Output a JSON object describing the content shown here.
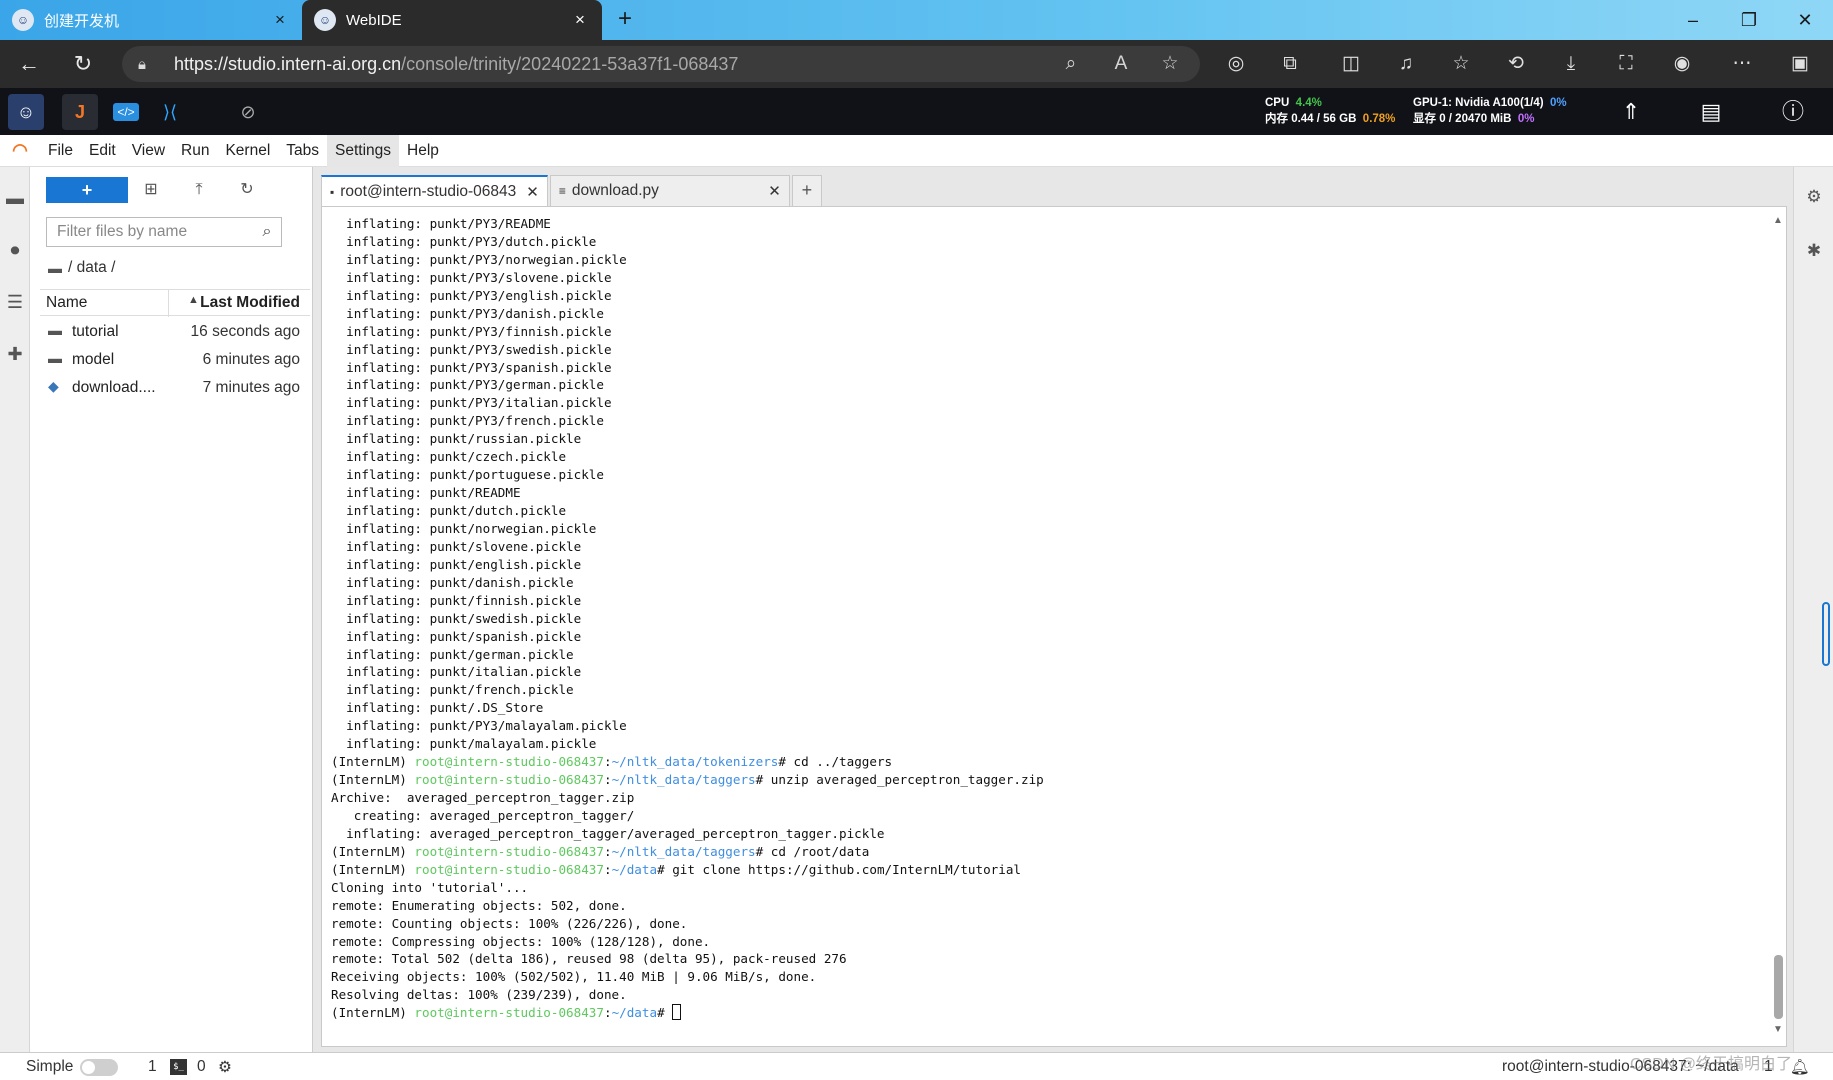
{
  "browser": {
    "tabs": [
      {
        "title": "创建开发机",
        "close": "×"
      },
      {
        "title": "WebIDE",
        "close": "×"
      }
    ],
    "new_tab": "+",
    "window_controls": {
      "minimize": "–",
      "maximize": "❐",
      "close": "✕"
    },
    "url_host": "https://studio.intern-ai.org.cn",
    "url_path": "/console/trinity/20240221-53a37f1-068437"
  },
  "ide_bar": {
    "cpu_label": "CPU",
    "cpu_value": "4.4%",
    "mem_label": "内存 0.44 / 56 GB",
    "mem_value": "0.78%",
    "gpu_label": "GPU-1: Nvidia A100(1/4)",
    "gpu_value": "0%",
    "vram_label": "显存 0 / 20470 MiB",
    "vram_value": "0%"
  },
  "menu": [
    "File",
    "Edit",
    "View",
    "Run",
    "Kernel",
    "Tabs",
    "Settings",
    "Help"
  ],
  "menu_selected": "Settings",
  "file_browser": {
    "new_label": "+",
    "filter_placeholder": "Filter files by name",
    "breadcrumb": "/ data /",
    "col_name": "Name",
    "col_modified": "Last Modified",
    "files": [
      {
        "name": "tutorial",
        "type": "folder",
        "modified": "16 seconds ago"
      },
      {
        "name": "model",
        "type": "folder",
        "modified": "6 minutes ago"
      },
      {
        "name": "download....",
        "type": "python",
        "modified": "7 minutes ago"
      }
    ]
  },
  "doc_tabs": [
    {
      "label": "root@intern-studio-06843",
      "icon": "terminal-icon",
      "close": "✕"
    },
    {
      "label": "download.py",
      "icon": "file-text-icon",
      "close": "✕"
    }
  ],
  "terminal": {
    "prompt_env": "(InternLM) ",
    "prompt_user": "root@intern-studio-068437",
    "lines": [
      {
        "text": "  inflating: punkt/PY3/README"
      },
      {
        "text": "  inflating: punkt/PY3/dutch.pickle"
      },
      {
        "text": "  inflating: punkt/PY3/norwegian.pickle"
      },
      {
        "text": "  inflating: punkt/PY3/slovene.pickle"
      },
      {
        "text": "  inflating: punkt/PY3/english.pickle"
      },
      {
        "text": "  inflating: punkt/PY3/danish.pickle"
      },
      {
        "text": "  inflating: punkt/PY3/finnish.pickle"
      },
      {
        "text": "  inflating: punkt/PY3/swedish.pickle"
      },
      {
        "text": "  inflating: punkt/PY3/spanish.pickle"
      },
      {
        "text": "  inflating: punkt/PY3/german.pickle"
      },
      {
        "text": "  inflating: punkt/PY3/italian.pickle"
      },
      {
        "text": "  inflating: punkt/PY3/french.pickle"
      },
      {
        "text": "  inflating: punkt/russian.pickle"
      },
      {
        "text": "  inflating: punkt/czech.pickle"
      },
      {
        "text": "  inflating: punkt/portuguese.pickle"
      },
      {
        "text": "  inflating: punkt/README"
      },
      {
        "text": "  inflating: punkt/dutch.pickle"
      },
      {
        "text": "  inflating: punkt/norwegian.pickle"
      },
      {
        "text": "  inflating: punkt/slovene.pickle"
      },
      {
        "text": "  inflating: punkt/english.pickle"
      },
      {
        "text": "  inflating: punkt/danish.pickle"
      },
      {
        "text": "  inflating: punkt/finnish.pickle"
      },
      {
        "text": "  inflating: punkt/swedish.pickle"
      },
      {
        "text": "  inflating: punkt/spanish.pickle"
      },
      {
        "text": "  inflating: punkt/german.pickle"
      },
      {
        "text": "  inflating: punkt/italian.pickle"
      },
      {
        "text": "  inflating: punkt/french.pickle"
      },
      {
        "text": "  inflating: punkt/.DS_Store"
      },
      {
        "text": "  inflating: punkt/PY3/malayalam.pickle"
      },
      {
        "text": "  inflating: punkt/malayalam.pickle"
      },
      {
        "prompt": true,
        "path": "~/nltk_data/tokenizers",
        "cmd": "# cd ../taggers"
      },
      {
        "prompt": true,
        "path": "~/nltk_data/taggers",
        "cmd": "# unzip averaged_perceptron_tagger.zip"
      },
      {
        "text": "Archive:  averaged_perceptron_tagger.zip"
      },
      {
        "text": "   creating: averaged_perceptron_tagger/"
      },
      {
        "text": "  inflating: averaged_perceptron_tagger/averaged_perceptron_tagger.pickle"
      },
      {
        "prompt": true,
        "path": "~/nltk_data/taggers",
        "cmd": "# cd /root/data"
      },
      {
        "prompt": true,
        "path": "~/data",
        "cmd": "# git clone https://github.com/InternLM/tutorial"
      },
      {
        "text": "Cloning into 'tutorial'..."
      },
      {
        "text": "remote: Enumerating objects: 502, done."
      },
      {
        "text": "remote: Counting objects: 100% (226/226), done."
      },
      {
        "text": "remote: Compressing objects: 100% (128/128), done."
      },
      {
        "text": "remote: Total 502 (delta 186), reused 98 (delta 95), pack-reused 276"
      },
      {
        "text": "Receiving objects: 100% (502/502), 11.40 MiB | 9.06 MiB/s, done."
      },
      {
        "text": "Resolving deltas: 100% (239/239), done."
      },
      {
        "prompt": true,
        "path": "~/data",
        "cmd": "# ",
        "cursor": true
      }
    ]
  },
  "status": {
    "mode": "Simple",
    "count1": "1",
    "count2": "0",
    "right_text": "root@intern-studio-068437: ~/data",
    "right_num": "1"
  },
  "watermark": "CSDN @终于搞明白了",
  "colors": {
    "accent": "#1976d2",
    "prompt_user": "#5fc95f",
    "prompt_path": "#3f8ee0",
    "jupyter_orange": "#f37726"
  }
}
